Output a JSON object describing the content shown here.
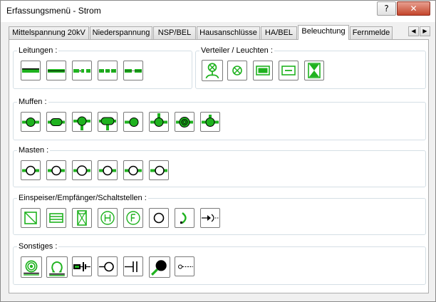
{
  "window": {
    "title": "Erfassungsmenü - Strom",
    "help_label": "?",
    "close_label": "✕"
  },
  "tabs": [
    {
      "label": "Mittelspannung 20kV",
      "active": false
    },
    {
      "label": "Niederspannung",
      "active": false
    },
    {
      "label": "NSP/BEL",
      "active": false
    },
    {
      "label": "Hausanschlüsse",
      "active": false
    },
    {
      "label": "HA/BEL",
      "active": false
    },
    {
      "label": "Beleuchtung",
      "active": true
    },
    {
      "label": "Fernmelde",
      "active": false
    }
  ],
  "tab_scroll": {
    "left_label": "◀",
    "right_label": "▶"
  },
  "colors": {
    "accent_green": "#1fb21f",
    "icon_dark": "#000000"
  },
  "groups": {
    "leitungen": {
      "label": "Leitungen :",
      "icons": [
        "line-solid-icon",
        "line-double-icon",
        "line-dashed-dot-icon",
        "line-dashed-icon",
        "line-break-icon"
      ]
    },
    "verteiler": {
      "label": "Verteiler / Leuchten :",
      "icons": [
        "distributor-lamp-icon",
        "lamp-circle-x-icon",
        "cabinet-filled-icon",
        "cabinet-line-icon",
        "cabinet-x-icon"
      ]
    },
    "muffen": {
      "label": "Muffen :",
      "icons": [
        "sleeve-circle-icon",
        "sleeve-oval-icon",
        "sleeve-tee-icon",
        "sleeve-tee-wide-icon",
        "sleeve-end-icon",
        "sleeve-branch-icon",
        "sleeve-ring-icon",
        "sleeve-open-icon"
      ]
    },
    "masten": {
      "label": "Masten :",
      "icons": [
        "mast-1-icon",
        "mast-2-icon",
        "mast-3-icon",
        "mast-4-icon",
        "mast-5-icon",
        "mast-6-icon"
      ]
    },
    "einspeiser": {
      "label": "Einspeiser/Empfänger/Schaltstellen :",
      "icons": [
        "feeder-diagonal-icon",
        "receiver-box-icon",
        "switch-x-icon",
        "h-circle-icon",
        "f-circle-icon",
        "open-circle-icon",
        "arc-icon",
        "plug-icon"
      ]
    },
    "sonstiges": {
      "label": "Sonstiges :",
      "icons": [
        "coil-icon",
        "omega-icon",
        "battery-icon",
        "circle-line-icon",
        "capacitor-icon",
        "filled-circle-icon",
        "dashed-end-icon"
      ]
    }
  }
}
